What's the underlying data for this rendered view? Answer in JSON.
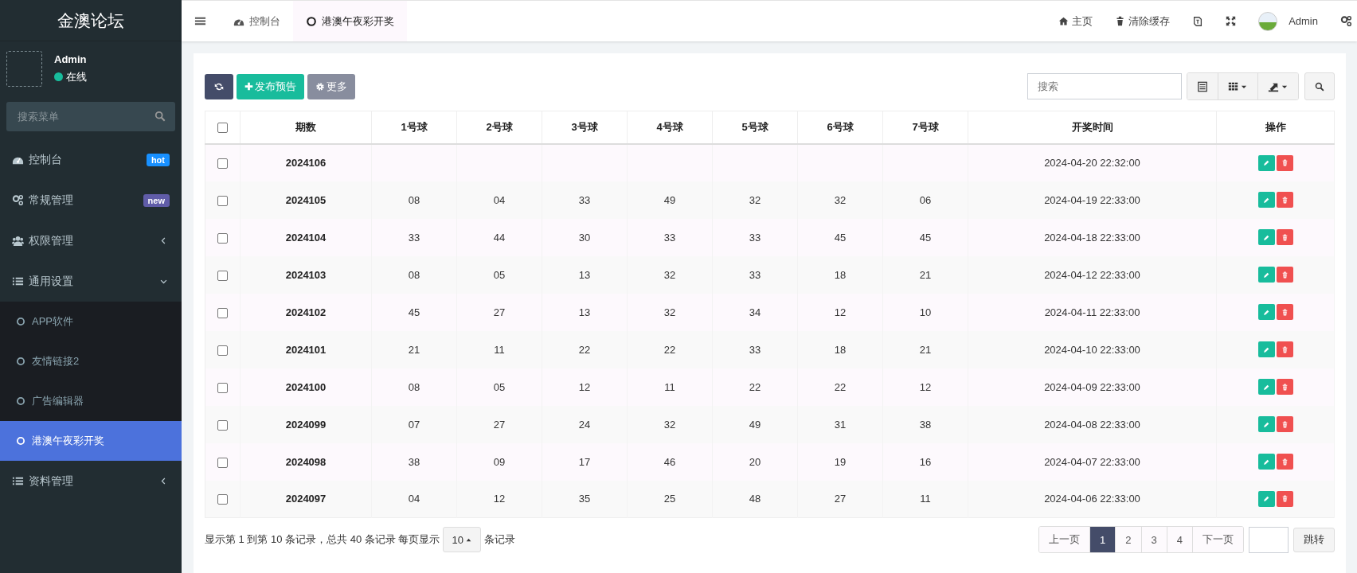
{
  "sidebar": {
    "logo": "金澳论坛",
    "user": {
      "name": "Admin",
      "status": "在线"
    },
    "search": {
      "placeholder": "搜索菜单"
    },
    "menu": [
      {
        "label": "控制台",
        "badge": {
          "text": "hot",
          "color": "#1890ff"
        }
      },
      {
        "label": "常规管理",
        "badge": {
          "text": "new",
          "color": "#605ca8"
        }
      },
      {
        "label": "权限管理",
        "expanded": false
      },
      {
        "label": "通用设置",
        "expanded": true,
        "children": [
          {
            "label": "APP软件",
            "selected": false
          },
          {
            "label": "友情链接2",
            "selected": false
          },
          {
            "label": "广告编辑器",
            "selected": false
          },
          {
            "label": "港澳午夜彩开奖",
            "selected": true
          }
        ]
      },
      {
        "label": "资料管理",
        "expanded": false
      }
    ]
  },
  "topbar": {
    "tabs": [
      {
        "label": "控制台",
        "selected": false
      },
      {
        "label": "港澳午夜彩开奖",
        "selected": true
      }
    ],
    "links": [
      "主页",
      "清除缓存"
    ],
    "user": "Admin"
  },
  "toolbar": {
    "buttons": [
      "发布预告",
      "更多"
    ],
    "search": {
      "placeholder": "搜索"
    }
  },
  "table": {
    "all_checked": false,
    "columns": [
      "期数",
      "1号球",
      "2号球",
      "3号球",
      "4号球",
      "5号球",
      "6号球",
      "7号球",
      "开奖时间",
      "操作"
    ],
    "rows": [
      {
        "checked": false,
        "cells": [
          "2024106",
          "",
          "",
          "",
          "",
          "",
          "",
          "",
          "2024-04-20 22:32:00"
        ]
      },
      {
        "checked": false,
        "cells": [
          "2024105",
          "08",
          "04",
          "33",
          "49",
          "32",
          "32",
          "06",
          "2024-04-19 22:33:00"
        ]
      },
      {
        "checked": false,
        "cells": [
          "2024104",
          "33",
          "44",
          "30",
          "33",
          "33",
          "45",
          "45",
          "2024-04-18 22:33:00"
        ]
      },
      {
        "checked": false,
        "cells": [
          "2024103",
          "08",
          "05",
          "13",
          "32",
          "33",
          "18",
          "21",
          "2024-04-12 22:33:00"
        ]
      },
      {
        "checked": false,
        "cells": [
          "2024102",
          "45",
          "27",
          "13",
          "32",
          "34",
          "12",
          "10",
          "2024-04-11 22:33:00"
        ]
      },
      {
        "checked": false,
        "cells": [
          "2024101",
          "21",
          "11",
          "22",
          "22",
          "33",
          "18",
          "21",
          "2024-04-10 22:33:00"
        ]
      },
      {
        "checked": false,
        "cells": [
          "2024100",
          "08",
          "05",
          "12",
          "11",
          "22",
          "22",
          "12",
          "2024-04-09 22:33:00"
        ]
      },
      {
        "checked": false,
        "cells": [
          "2024099",
          "07",
          "27",
          "24",
          "32",
          "49",
          "31",
          "38",
          "2024-04-08 22:33:00"
        ]
      },
      {
        "checked": false,
        "cells": [
          "2024098",
          "38",
          "09",
          "17",
          "46",
          "20",
          "19",
          "16",
          "2024-04-07 22:33:00"
        ]
      },
      {
        "checked": false,
        "cells": [
          "2024097",
          "04",
          "12",
          "35",
          "25",
          "48",
          "27",
          "11",
          "2024-04-06 22:33:00"
        ]
      }
    ]
  },
  "footer": {
    "summary": "显示第 1 到第 10 条记录，总共 40 条记录 每页显示",
    "page_size": "10",
    "summary_end": "条记录",
    "prev": "上一页",
    "pages": [
      {
        "label": "1",
        "selected": true
      },
      {
        "label": "2",
        "selected": false
      },
      {
        "label": "3",
        "selected": false
      },
      {
        "label": "4",
        "selected": false
      }
    ],
    "next": "下一页",
    "jump": "跳转"
  }
}
